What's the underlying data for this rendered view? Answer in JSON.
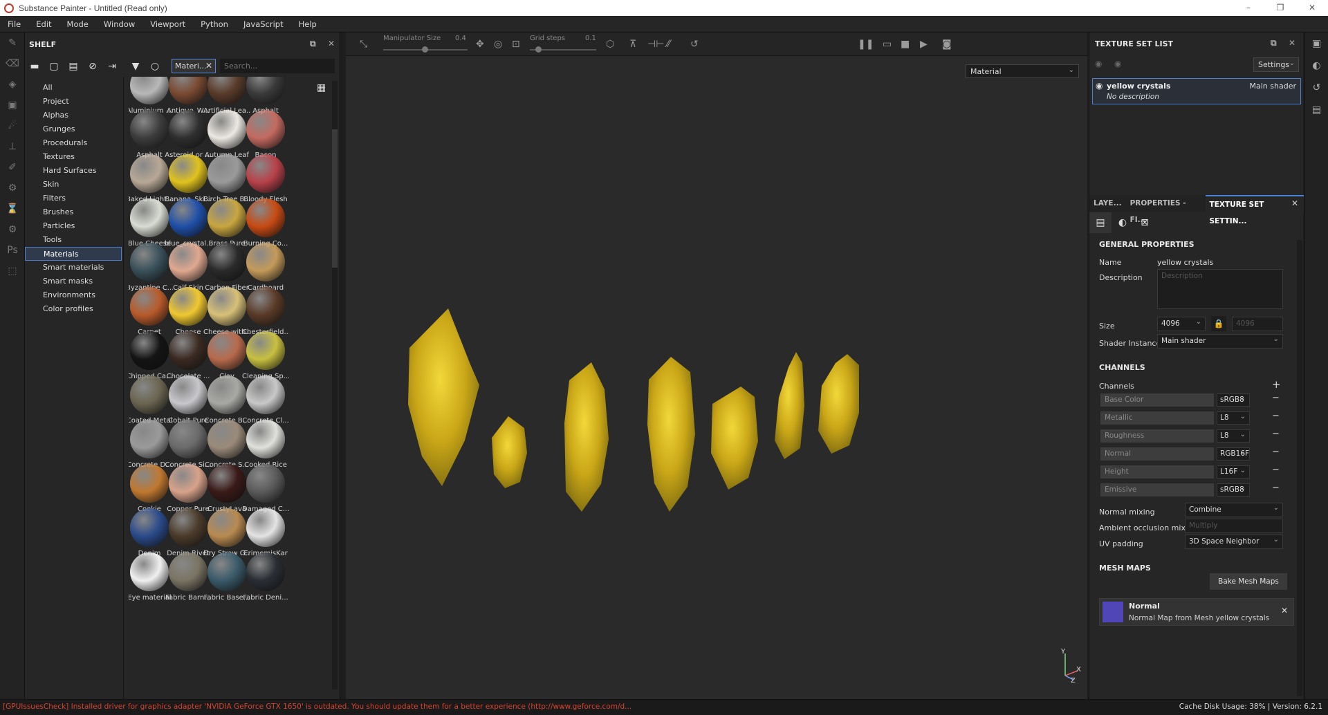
{
  "window": {
    "title": "Substance Painter - Untitled (Read only)"
  },
  "menu": [
    "File",
    "Edit",
    "Mode",
    "Window",
    "Viewport",
    "Python",
    "JavaScript",
    "Help"
  ],
  "shelf": {
    "title": "SHELF",
    "filter_chip": "Materi...",
    "search_placeholder": "Search...",
    "categories": [
      "All",
      "Project",
      "Alphas",
      "Grunges",
      "Procedurals",
      "Textures",
      "Hard Surfaces",
      "Skin",
      "Filters",
      "Brushes",
      "Particles",
      "Tools",
      "Materials",
      "Smart materials",
      "Smart masks",
      "Environments",
      "Color profiles"
    ],
    "selected_category": "Materials",
    "materials": [
      {
        "label": "Aluminium ...",
        "color": "#b8b8b8"
      },
      {
        "label": "Antique_W...",
        "color": "#7a4a32"
      },
      {
        "label": "Artificial Lea...",
        "color": "#5a3b2a"
      },
      {
        "label": "Asphalt",
        "color": "#3a3a3a"
      },
      {
        "label": "Asphalt",
        "color": "#3c3c3c"
      },
      {
        "label": "Asteroid or ...",
        "color": "#2f2f2f"
      },
      {
        "label": "Autumn Leaf",
        "color": "#ece8e2"
      },
      {
        "label": "Bacon",
        "color": "#c46a60"
      },
      {
        "label": "Baked Light...",
        "color": "#b8a896"
      },
      {
        "label": "Banana_Ski...",
        "color": "#e0c21e"
      },
      {
        "label": "Birch Tree B...",
        "color": "#9a9a9a"
      },
      {
        "label": "Bloody Flesh",
        "color": "#b8414a"
      },
      {
        "label": "Blue Cheese",
        "color": "#d8dcd2"
      },
      {
        "label": "blue_crystal...",
        "color": "#1f4fa8"
      },
      {
        "label": "Brass Pure",
        "color": "#c8a640"
      },
      {
        "label": "Burning Co...",
        "color": "#c84a14"
      },
      {
        "label": "Byzantine C...",
        "color": "#39505a"
      },
      {
        "label": "Calf Skin",
        "color": "#e0a890"
      },
      {
        "label": "Carbon Fiber",
        "color": "#2a2a2a"
      },
      {
        "label": "Cardboard",
        "color": "#c49a5a"
      },
      {
        "label": "Carpet",
        "color": "#b85a2a"
      },
      {
        "label": "Cheese",
        "color": "#f0c830"
      },
      {
        "label": "Cheese with...",
        "color": "#d8c078"
      },
      {
        "label": "Chesterfield...",
        "color": "#5a3a28"
      },
      {
        "label": "Chipped Ca...",
        "color": "#141414"
      },
      {
        "label": "Chocolate ...",
        "color": "#3a2a22"
      },
      {
        "label": "Clay",
        "color": "#b86a4c"
      },
      {
        "label": "Cleaning Sp...",
        "color": "#c8c040"
      },
      {
        "label": "Coated Metal",
        "color": "#6a6450"
      },
      {
        "label": "Cobalt Pure",
        "color": "#c8c8cc"
      },
      {
        "label": "Concrete B...",
        "color": "#a8a8a4"
      },
      {
        "label": "Concrete Cl...",
        "color": "#c8c8c8"
      },
      {
        "label": "Concrete D...",
        "color": "#9a9a9a"
      },
      {
        "label": "Concrete Si...",
        "color": "#6a6a6a"
      },
      {
        "label": "Concrete S...",
        "color": "#9a8a7a"
      },
      {
        "label": "Cooked Rice",
        "color": "#e0e0dc"
      },
      {
        "label": "Cookie",
        "color": "#c07830"
      },
      {
        "label": "Copper Pure",
        "color": "#d8a28a"
      },
      {
        "label": "CrustyLava",
        "color": "#3a1a18"
      },
      {
        "label": "Damaged C...",
        "color": "#5a5a5a"
      },
      {
        "label": "Denim",
        "color": "#2a4a8a"
      },
      {
        "label": "Denim Rivet",
        "color": "#4a3a2a"
      },
      {
        "label": "Dry Straw G...",
        "color": "#b88a50"
      },
      {
        "label": "ErimemisKar",
        "color": "#e4e4e4"
      },
      {
        "label": "Eye material",
        "color": "#f0f0f0"
      },
      {
        "label": "Fabric Barn...",
        "color": "#7a7464"
      },
      {
        "label": "Fabric Base...",
        "color": "#3a5a6a"
      },
      {
        "label": "Fabric Deni...",
        "color": "#2a2e34"
      }
    ]
  },
  "viewport": {
    "manipulator_label": "Manipulator Size",
    "manipulator_value": "0.4",
    "grid_label": "Grid steps",
    "grid_value": "0.1",
    "display_mode": "Material",
    "axis_y": "Y",
    "axis_x": "X",
    "axis_z": "Z"
  },
  "texture_set_list": {
    "title": "TEXTURE SET LIST",
    "settings_label": "Settings",
    "item_name": "yellow crystals",
    "item_shader": "Main shader",
    "item_description": "No description"
  },
  "properties_tabs": [
    "LAYE...",
    "PROPERTIES - FI...",
    "TEXTURE SET SETTIN..."
  ],
  "general_properties": {
    "section": "GENERAL PROPERTIES",
    "name_label": "Name",
    "name_value": "yellow crystals",
    "description_label": "Description",
    "description_placeholder": "Description",
    "size_label": "Size",
    "size_value": "4096",
    "size_locked_value": "4096",
    "shader_label": "Shader Instance",
    "shader_value": "Main shader"
  },
  "channels": {
    "section": "CHANNELS",
    "label": "Channels",
    "items": [
      {
        "name": "Base Color",
        "format": "sRGB8"
      },
      {
        "name": "Metallic",
        "format": "L8"
      },
      {
        "name": "Roughness",
        "format": "L8"
      },
      {
        "name": "Normal",
        "format": "RGB16F"
      },
      {
        "name": "Height",
        "format": "L16F"
      },
      {
        "name": "Emissive",
        "format": "sRGB8"
      }
    ],
    "normal_mixing_label": "Normal mixing",
    "normal_mixing_value": "Combine",
    "ao_mixing_label": "Ambient occlusion mixing",
    "ao_mixing_value": "Multiply",
    "uv_padding_label": "UV padding",
    "uv_padding_value": "3D Space Neighbor"
  },
  "mesh_maps": {
    "section": "MESH MAPS",
    "bake_label": "Bake Mesh Maps",
    "normal_title": "Normal",
    "normal_desc": "Normal Map from Mesh yellow crystals"
  },
  "status": {
    "message": "[GPUIssuesCheck] Installed driver for graphics adapter 'NVIDIA GeForce GTX 1650' is outdated. You should update them for a better experience (http://www.geforce.com/d...",
    "cache": "Cache Disk Usage:",
    "cache_value": "38%",
    "version": "Version: 6.2.1"
  },
  "colors": {
    "accent": "#4d7fd1",
    "crystal": "#d9b81a",
    "error": "#d9432f"
  }
}
